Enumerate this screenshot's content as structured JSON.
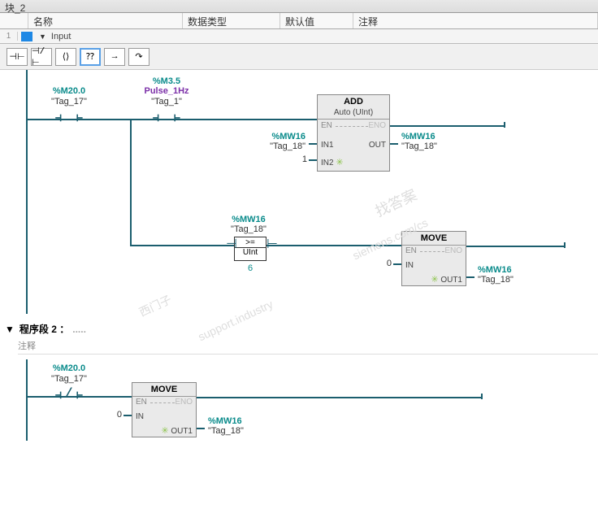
{
  "title": "块_2",
  "columns": {
    "name": "名称",
    "dtype": "数据类型",
    "default": "默认值",
    "comment": "注释"
  },
  "row1": {
    "idx": "1",
    "label": "Input"
  },
  "toolbar": {
    "nc": "⊣⊢",
    "ncn": "⊣/⊢",
    "coil": "⟨⟩",
    "box": "⁇",
    "arrow": "→",
    "step": "↷"
  },
  "net1": {
    "c1": {
      "addr": "%M20.0",
      "tag": "\"Tag_17\""
    },
    "c2": {
      "addr": "%M3.5",
      "sym": "Pulse_1Hz",
      "tag": "\"Tag_1\""
    },
    "add": {
      "title": "ADD",
      "sub": "Auto (UInt)",
      "en": "EN",
      "eno": "ENO",
      "in1": "IN1",
      "in2": "IN2",
      "out": "OUT"
    },
    "add_in1": {
      "addr": "%MW16",
      "tag": "\"Tag_18\""
    },
    "add_in2": "1",
    "add_out": {
      "addr": "%MW16",
      "tag": "\"Tag_18\""
    },
    "cmp": {
      "addr": "%MW16",
      "tag": "\"Tag_18\"",
      "op": ">=",
      "type": "UInt",
      "val": "6"
    },
    "move": {
      "title": "MOVE",
      "en": "EN",
      "eno": "ENO",
      "in": "IN",
      "out1": "OUT1"
    },
    "move_in": "0",
    "move_out": {
      "addr": "%MW16",
      "tag": "\"Tag_18\""
    }
  },
  "seg2": {
    "title": "程序段 2 ：",
    "dots": ".....",
    "comment": "注释"
  },
  "net2": {
    "c1": {
      "addr": "%M20.0",
      "tag": "\"Tag_17\""
    },
    "move": {
      "title": "MOVE",
      "en": "EN",
      "eno": "ENO",
      "in": "IN",
      "out1": "OUT1"
    },
    "move_in": "0",
    "move_out": {
      "addr": "%MW16",
      "tag": "\"Tag_18\""
    }
  },
  "watermarks": {
    "a": "找答案",
    "b": "siemens.com/cs",
    "c": "support.industry",
    "d": "西门子"
  }
}
